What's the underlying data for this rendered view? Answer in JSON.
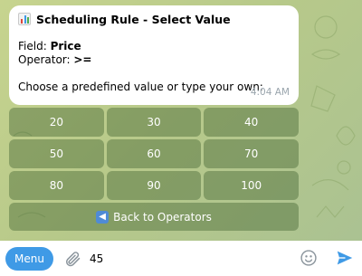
{
  "message": {
    "title": "Scheduling Rule - Select Value",
    "title_icon": "bar-chart-emoji",
    "field_label": "Field: ",
    "field_value": "Price",
    "operator_label": "Operator: ",
    "operator_value": ">=",
    "prompt": "Choose a predefined value or type your own:",
    "time": "4:04 AM"
  },
  "keyboard": {
    "rows": [
      [
        "20",
        "30",
        "40"
      ],
      [
        "50",
        "60",
        "70"
      ],
      [
        "80",
        "90",
        "100"
      ]
    ],
    "back_label": "Back to Operators",
    "back_icon": "left-arrow-emoji"
  },
  "input_bar": {
    "menu_label": "Menu",
    "message_value": "45",
    "icons": [
      "paperclip-icon",
      "emoji-icon",
      "send-icon"
    ]
  },
  "colors": {
    "accent": "#3f9ae6",
    "keyboard_button": "#6a8a4a",
    "timestamp": "#9aa5ad"
  }
}
